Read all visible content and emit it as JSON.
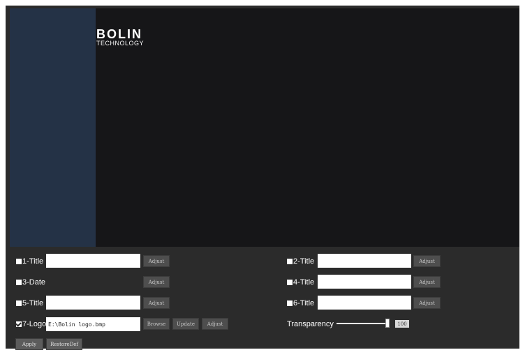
{
  "logo": {
    "brand": "BOLIN",
    "sub": "TECHNOLOGY"
  },
  "osd": {
    "items": [
      {
        "label": "1-Title",
        "checked": false,
        "value": "",
        "adjust": "Adjust"
      },
      {
        "label": "2-Title",
        "checked": false,
        "value": "",
        "adjust": "Adjust"
      },
      {
        "label": "3-Date",
        "checked": false,
        "adjust": "Adjust"
      },
      {
        "label": "4-Title",
        "checked": false,
        "value": "",
        "adjust": "Adjust"
      },
      {
        "label": "5-Title",
        "checked": false,
        "value": "",
        "adjust": "Adjust"
      },
      {
        "label": "6-Title",
        "checked": false,
        "value": "",
        "adjust": "Adjust"
      },
      {
        "label": "7-Logo",
        "checked": true,
        "value": "E:\\Bolin logo.bmp",
        "browse": "Browse",
        "update": "Update",
        "adjust": "Adjust"
      }
    ],
    "transparency": {
      "label": "Transparency",
      "value": "100",
      "level": 1.0
    },
    "apply": "Apply",
    "restore": "RestoreDef"
  }
}
